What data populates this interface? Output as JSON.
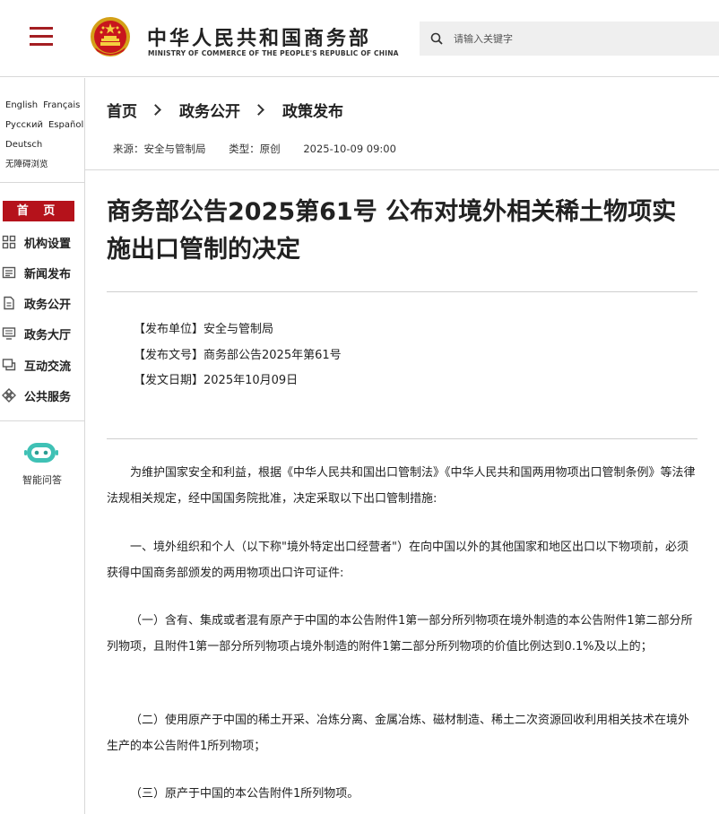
{
  "header": {
    "site_name_cn": "中华人民共和国商务部",
    "site_name_en": "MINISTRY OF COMMERCE OF THE PEOPLE'S REPUBLIC OF CHINA",
    "search_placeholder": "请输入关键字",
    "colors": {
      "brand_red": "#b5121b",
      "menu_red": "#a41e22"
    }
  },
  "sidebar": {
    "languages_row1": [
      "English",
      "Français"
    ],
    "languages_row2": [
      "Русский",
      "Español"
    ],
    "languages_row3": [
      "Deutsch"
    ],
    "accessibility": "无障碍浏览",
    "home": "首 页",
    "items": [
      {
        "label": "机构设置",
        "icon": "org-grid-icon"
      },
      {
        "label": "新闻发布",
        "icon": "newspaper-icon"
      },
      {
        "label": "政务公开",
        "icon": "document-icon"
      },
      {
        "label": "政务大厅",
        "icon": "monitor-icon"
      },
      {
        "label": "互动交流",
        "icon": "chat-icon"
      },
      {
        "label": "公共服务",
        "icon": "service-icon"
      }
    ],
    "assistant_label": "智能问答"
  },
  "breadcrumb": [
    "首页",
    "政务公开",
    "政策发布"
  ],
  "meta": {
    "source": "来源：安全与管制局",
    "type": "类型：原创",
    "datetime": "2025-10-09 09:00"
  },
  "article": {
    "title": "商务部公告2025第61号 公布对境外相关稀土物项实施出口管制的决定",
    "issuer": "【发布单位】安全与管制局",
    "doc_no": "【发布文号】商务部公告2025年第61号",
    "date": "【发文日期】2025年10月09日",
    "paragraphs": [
      "为维护国家安全和利益，根据《中华人民共和国出口管制法》《中华人民共和国两用物项出口管制条例》等法律法规相关规定，经中国国务院批准，决定采取以下出口管制措施:",
      "一、境外组织和个人（以下称\"境外特定出口经营者\"）在向中国以外的其他国家和地区出口以下物项前，必须获得中国商务部颁发的两用物项出口许可证件:",
      "（一）含有、集成或者混有原产于中国的本公告附件1第一部分所列物项在境外制造的本公告附件1第二部分所列物项，且附件1第一部分所列物项占境外制造的附件1第二部分所列物项的价值比例达到0.1%及以上的；",
      "（二）使用原产于中国的稀土开采、冶炼分离、金属冶炼、磁材制造、稀土二次资源回收利用相关技术在境外生产的本公告附件1所列物项；",
      "（三）原产于中国的本公告附件1所列物项。"
    ]
  }
}
